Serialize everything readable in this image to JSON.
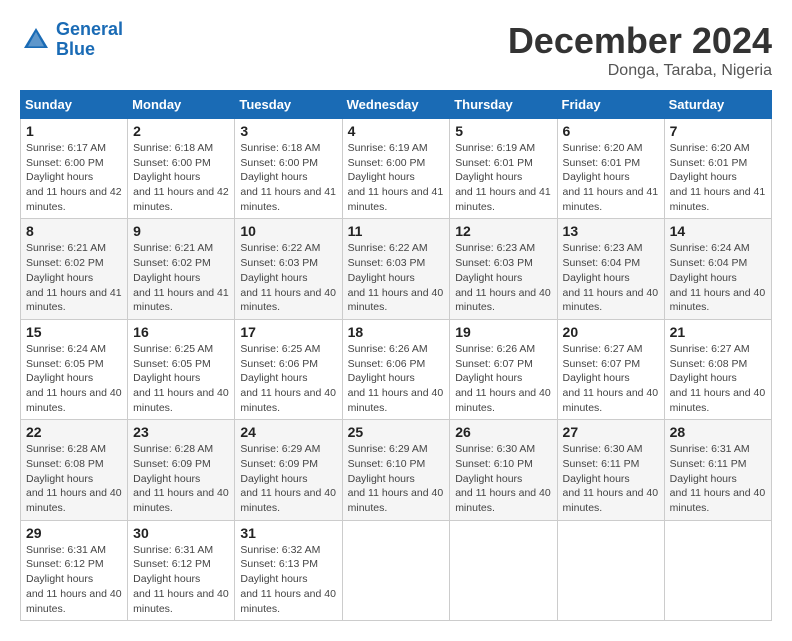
{
  "logo": {
    "line1": "General",
    "line2": "Blue"
  },
  "title": "December 2024",
  "location": "Donga, Taraba, Nigeria",
  "days_header": [
    "Sunday",
    "Monday",
    "Tuesday",
    "Wednesday",
    "Thursday",
    "Friday",
    "Saturday"
  ],
  "weeks": [
    [
      {
        "day": "1",
        "sunrise": "6:17 AM",
        "sunset": "6:00 PM",
        "daylight": "11 hours and 42 minutes."
      },
      {
        "day": "2",
        "sunrise": "6:18 AM",
        "sunset": "6:00 PM",
        "daylight": "11 hours and 42 minutes."
      },
      {
        "day": "3",
        "sunrise": "6:18 AM",
        "sunset": "6:00 PM",
        "daylight": "11 hours and 41 minutes."
      },
      {
        "day": "4",
        "sunrise": "6:19 AM",
        "sunset": "6:00 PM",
        "daylight": "11 hours and 41 minutes."
      },
      {
        "day": "5",
        "sunrise": "6:19 AM",
        "sunset": "6:01 PM",
        "daylight": "11 hours and 41 minutes."
      },
      {
        "day": "6",
        "sunrise": "6:20 AM",
        "sunset": "6:01 PM",
        "daylight": "11 hours and 41 minutes."
      },
      {
        "day": "7",
        "sunrise": "6:20 AM",
        "sunset": "6:01 PM",
        "daylight": "11 hours and 41 minutes."
      }
    ],
    [
      {
        "day": "8",
        "sunrise": "6:21 AM",
        "sunset": "6:02 PM",
        "daylight": "11 hours and 41 minutes."
      },
      {
        "day": "9",
        "sunrise": "6:21 AM",
        "sunset": "6:02 PM",
        "daylight": "11 hours and 41 minutes."
      },
      {
        "day": "10",
        "sunrise": "6:22 AM",
        "sunset": "6:03 PM",
        "daylight": "11 hours and 40 minutes."
      },
      {
        "day": "11",
        "sunrise": "6:22 AM",
        "sunset": "6:03 PM",
        "daylight": "11 hours and 40 minutes."
      },
      {
        "day": "12",
        "sunrise": "6:23 AM",
        "sunset": "6:03 PM",
        "daylight": "11 hours and 40 minutes."
      },
      {
        "day": "13",
        "sunrise": "6:23 AM",
        "sunset": "6:04 PM",
        "daylight": "11 hours and 40 minutes."
      },
      {
        "day": "14",
        "sunrise": "6:24 AM",
        "sunset": "6:04 PM",
        "daylight": "11 hours and 40 minutes."
      }
    ],
    [
      {
        "day": "15",
        "sunrise": "6:24 AM",
        "sunset": "6:05 PM",
        "daylight": "11 hours and 40 minutes."
      },
      {
        "day": "16",
        "sunrise": "6:25 AM",
        "sunset": "6:05 PM",
        "daylight": "11 hours and 40 minutes."
      },
      {
        "day": "17",
        "sunrise": "6:25 AM",
        "sunset": "6:06 PM",
        "daylight": "11 hours and 40 minutes."
      },
      {
        "day": "18",
        "sunrise": "6:26 AM",
        "sunset": "6:06 PM",
        "daylight": "11 hours and 40 minutes."
      },
      {
        "day": "19",
        "sunrise": "6:26 AM",
        "sunset": "6:07 PM",
        "daylight": "11 hours and 40 minutes."
      },
      {
        "day": "20",
        "sunrise": "6:27 AM",
        "sunset": "6:07 PM",
        "daylight": "11 hours and 40 minutes."
      },
      {
        "day": "21",
        "sunrise": "6:27 AM",
        "sunset": "6:08 PM",
        "daylight": "11 hours and 40 minutes."
      }
    ],
    [
      {
        "day": "22",
        "sunrise": "6:28 AM",
        "sunset": "6:08 PM",
        "daylight": "11 hours and 40 minutes."
      },
      {
        "day": "23",
        "sunrise": "6:28 AM",
        "sunset": "6:09 PM",
        "daylight": "11 hours and 40 minutes."
      },
      {
        "day": "24",
        "sunrise": "6:29 AM",
        "sunset": "6:09 PM",
        "daylight": "11 hours and 40 minutes."
      },
      {
        "day": "25",
        "sunrise": "6:29 AM",
        "sunset": "6:10 PM",
        "daylight": "11 hours and 40 minutes."
      },
      {
        "day": "26",
        "sunrise": "6:30 AM",
        "sunset": "6:10 PM",
        "daylight": "11 hours and 40 minutes."
      },
      {
        "day": "27",
        "sunrise": "6:30 AM",
        "sunset": "6:11 PM",
        "daylight": "11 hours and 40 minutes."
      },
      {
        "day": "28",
        "sunrise": "6:31 AM",
        "sunset": "6:11 PM",
        "daylight": "11 hours and 40 minutes."
      }
    ],
    [
      {
        "day": "29",
        "sunrise": "6:31 AM",
        "sunset": "6:12 PM",
        "daylight": "11 hours and 40 minutes."
      },
      {
        "day": "30",
        "sunrise": "6:31 AM",
        "sunset": "6:12 PM",
        "daylight": "11 hours and 40 minutes."
      },
      {
        "day": "31",
        "sunrise": "6:32 AM",
        "sunset": "6:13 PM",
        "daylight": "11 hours and 40 minutes."
      },
      null,
      null,
      null,
      null
    ]
  ]
}
